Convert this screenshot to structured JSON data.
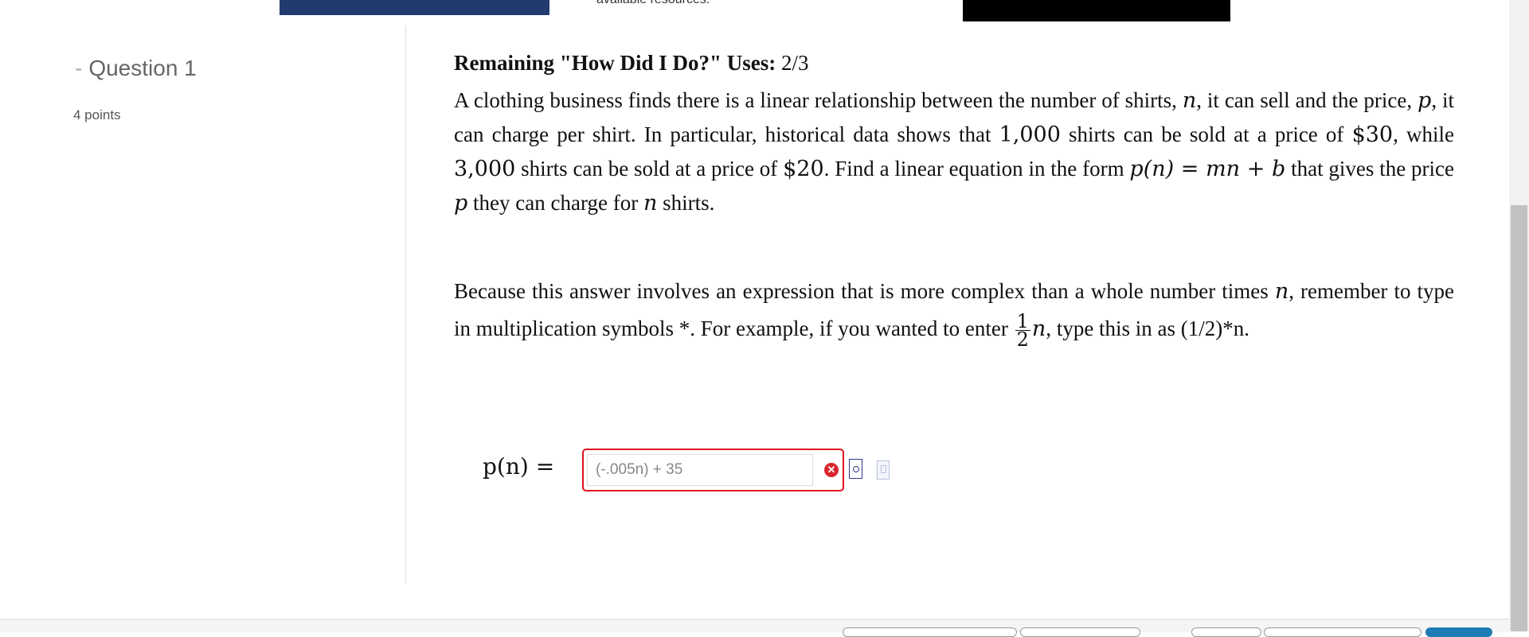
{
  "top": {
    "snippet": "available resources."
  },
  "question": {
    "heading": "Question 1",
    "points": "4 points"
  },
  "content": {
    "remaining_label": "Remaining \"How Did I Do?\" Uses:",
    "remaining_value": "2/3",
    "p1": {
      "t1": "A clothing business finds there is a linear relationship between the number of shirts, ",
      "v_n": "n",
      "t2": ", it can sell and the price, ",
      "v_p": "p",
      "t3": ", it can charge per shirt. In particular, historical data shows that ",
      "num1": "1,000",
      "t4": " shirts can be sold at a price of ",
      "num2": "$30",
      "t5": ", while ",
      "num3": "3,000",
      "t6": " shirts can be sold at a price of ",
      "num4": "$20",
      "t7": ". Find a linear equation in the form ",
      "formula": "p(n) = mn + b",
      "t8": " that gives the price ",
      "v_p2": "p",
      "t9": " they can charge for ",
      "v_n2": "n",
      "t10": " shirts."
    },
    "p2": {
      "t1": "Because this answer involves an expression that is more complex than a whole number times ",
      "v_n": "n",
      "t2": ", remember to type in multiplication symbols *. For example, if you wanted to enter ",
      "frac_num": "1",
      "frac_den": "2",
      "v_n2": "n",
      "t3": ", type this in as (1/2)*n."
    }
  },
  "answer": {
    "label": "p(n) =",
    "value": "(-.005n) + 35",
    "error_symbol": "✕"
  },
  "colors": {
    "banner": "#233a6e",
    "error": "#e0121f"
  }
}
